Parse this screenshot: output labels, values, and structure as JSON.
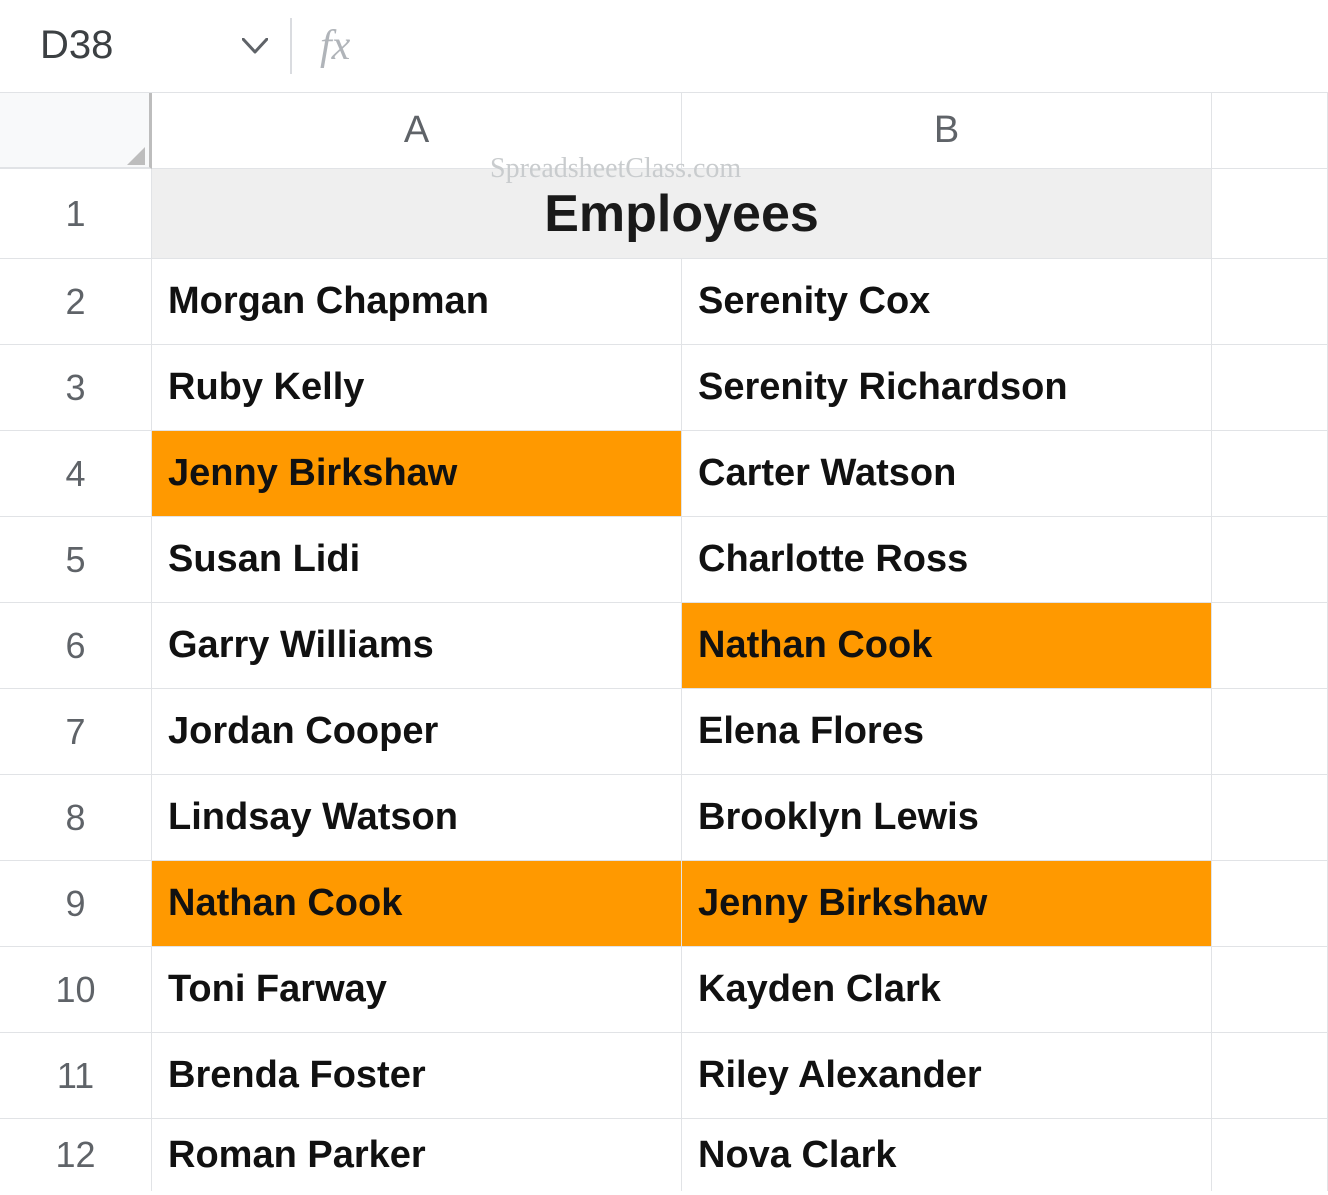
{
  "namebox": {
    "value": "D38"
  },
  "formula_bar": {
    "fx_label": "fx",
    "value": ""
  },
  "watermark": "SpreadsheetClass.com",
  "columns": [
    "A",
    "B"
  ],
  "row_numbers": [
    "1",
    "2",
    "3",
    "4",
    "5",
    "6",
    "7",
    "8",
    "9",
    "10",
    "11",
    "12"
  ],
  "title_row": {
    "text": "Employees"
  },
  "highlight_color": "#ff9900",
  "grid": {
    "rows": [
      {
        "a": "Morgan Chapman",
        "a_hl": false,
        "b": "Serenity Cox",
        "b_hl": false
      },
      {
        "a": "Ruby Kelly",
        "a_hl": false,
        "b": "Serenity Richardson",
        "b_hl": false
      },
      {
        "a": "Jenny Birkshaw",
        "a_hl": true,
        "b": "Carter Watson",
        "b_hl": false
      },
      {
        "a": "Susan Lidi",
        "a_hl": false,
        "b": "Charlotte Ross",
        "b_hl": false
      },
      {
        "a": "Garry Williams",
        "a_hl": false,
        "b": "Nathan Cook",
        "b_hl": true
      },
      {
        "a": "Jordan Cooper",
        "a_hl": false,
        "b": "Elena Flores",
        "b_hl": false
      },
      {
        "a": "Lindsay Watson",
        "a_hl": false,
        "b": "Brooklyn Lewis",
        "b_hl": false
      },
      {
        "a": "Nathan Cook",
        "a_hl": true,
        "b": "Jenny Birkshaw",
        "b_hl": true
      },
      {
        "a": "Toni Farway",
        "a_hl": false,
        "b": "Kayden Clark",
        "b_hl": false
      },
      {
        "a": "Brenda Foster",
        "a_hl": false,
        "b": "Riley Alexander",
        "b_hl": false
      },
      {
        "a": "Roman Parker",
        "a_hl": false,
        "b": "Nova Clark",
        "b_hl": false
      }
    ]
  }
}
